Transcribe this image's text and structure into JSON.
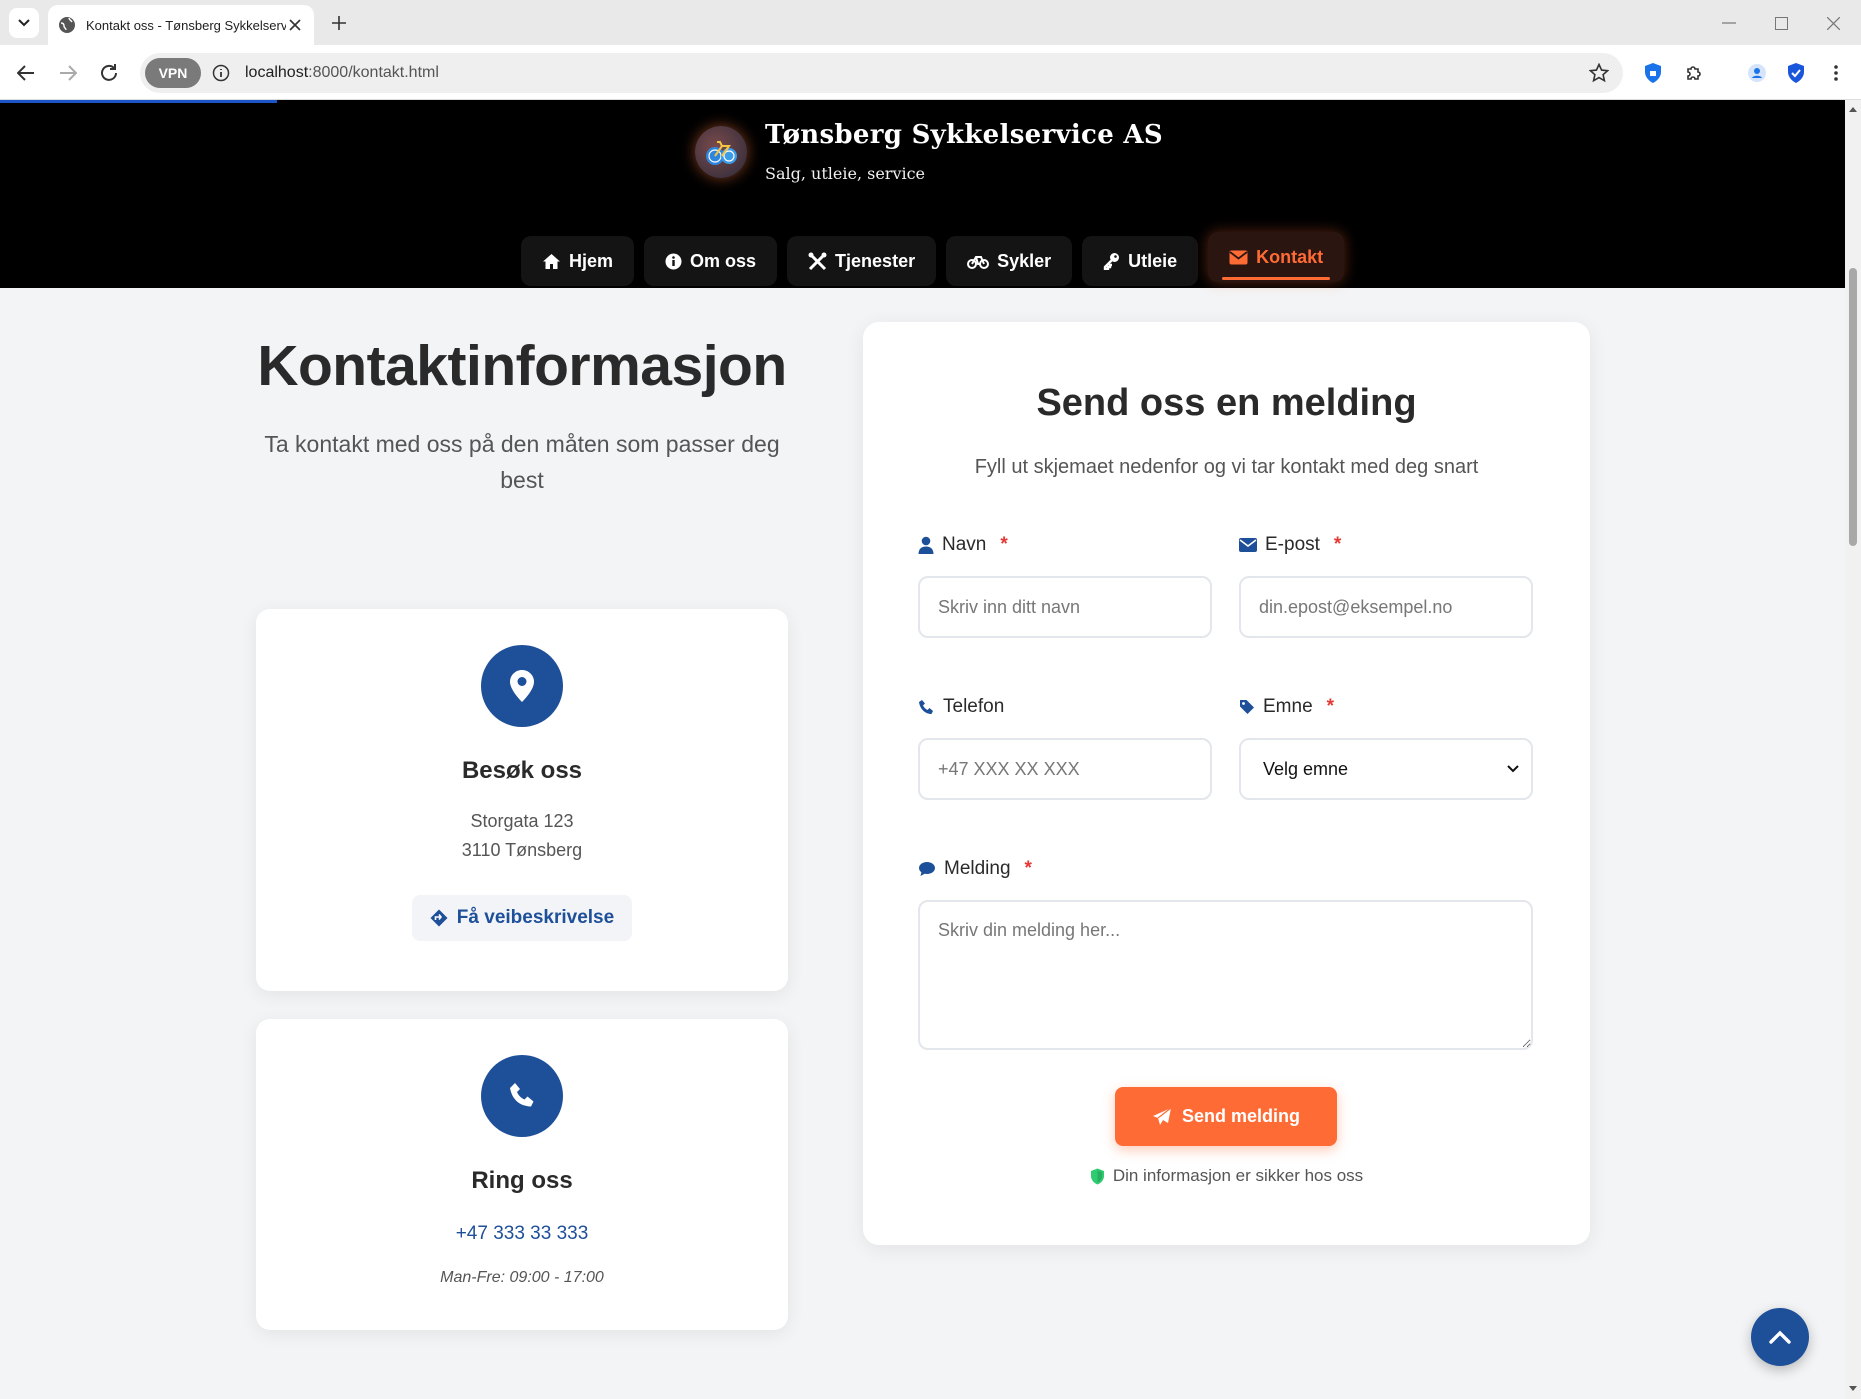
{
  "browser": {
    "tab_title": "Kontakt oss - Tønsberg Sykkelserv",
    "url_host": "localhost",
    "url_rest": ":8000/kontakt.html",
    "vpn_label": "VPN"
  },
  "site": {
    "title": "Tønsberg Sykkelservice AS",
    "tagline": "Salg, utleie, service"
  },
  "nav": [
    {
      "label": "Hjem",
      "icon": "home-icon"
    },
    {
      "label": "Om oss",
      "icon": "info-icon"
    },
    {
      "label": "Tjenester",
      "icon": "tools-icon"
    },
    {
      "label": "Sykler",
      "icon": "bicycle-icon"
    },
    {
      "label": "Utleie",
      "icon": "key-icon"
    },
    {
      "label": "Kontakt",
      "icon": "envelope-icon",
      "active": true
    }
  ],
  "contact": {
    "heading": "Kontaktinformasjon",
    "subtitle": "Ta kontakt med oss på den måten som passer deg best",
    "visit": {
      "title": "Besøk oss",
      "address_line1": "Storgata 123",
      "address_line2": "3110 Tønsberg",
      "directions_label": "Få veibeskrivelse"
    },
    "call": {
      "title": "Ring oss",
      "phone": "+47 333 33 333",
      "hours": "Man-Fre: 09:00 - 17:00"
    }
  },
  "form": {
    "title": "Send oss en melding",
    "subtitle": "Fyll ut skjemaet nedenfor og vi tar kontakt med deg snart",
    "name_label": "Navn",
    "name_placeholder": "Skriv inn ditt navn",
    "email_label": "E-post",
    "email_placeholder": "din.epost@eksempel.no",
    "phone_label": "Telefon",
    "phone_placeholder": "+47 XXX XX XXX",
    "subject_label": "Emne",
    "subject_selected": "Velg emne",
    "message_label": "Melding",
    "message_placeholder": "Skriv din melding her...",
    "required_mark": "*",
    "submit_label": "Send melding",
    "secure_note": "Din informasjon er sikker hos oss"
  },
  "colors": {
    "brand_blue": "#1e4f99",
    "accent_orange": "#ff6b35",
    "header_bg": "#000000"
  }
}
